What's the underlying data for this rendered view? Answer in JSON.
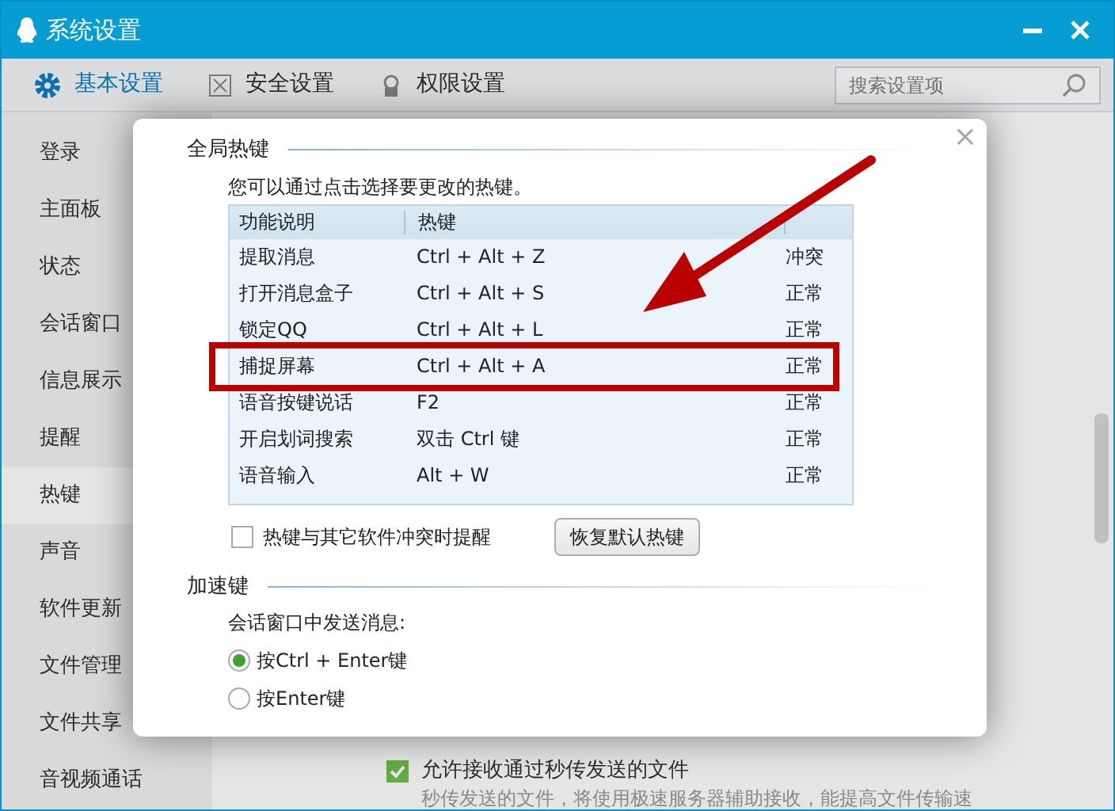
{
  "window": {
    "title": "系统设置"
  },
  "tabs": [
    {
      "label": "基本设置",
      "selected": true
    },
    {
      "label": "安全设置",
      "selected": false
    },
    {
      "label": "权限设置",
      "selected": false
    }
  ],
  "search": {
    "placeholder": "搜索设置项"
  },
  "sidebar": {
    "items": [
      {
        "label": "登录",
        "selected": false
      },
      {
        "label": "主面板",
        "selected": false
      },
      {
        "label": "状态",
        "selected": false
      },
      {
        "label": "会话窗口",
        "selected": false
      },
      {
        "label": "信息展示",
        "selected": false
      },
      {
        "label": "提醒",
        "selected": false
      },
      {
        "label": "热键",
        "selected": true
      },
      {
        "label": "声音",
        "selected": false
      },
      {
        "label": "软件更新",
        "selected": false
      },
      {
        "label": "文件管理",
        "selected": false
      },
      {
        "label": "文件共享",
        "selected": false
      },
      {
        "label": "音视频通话",
        "selected": false
      }
    ]
  },
  "background_option": {
    "label": "允许接收通过秒传发送的文件",
    "checked": true,
    "description": "秒传发送的文件，将使用极速服务器辅助接收，能提高文件传输速"
  },
  "dialog": {
    "close": "×",
    "global_hotkeys": {
      "title": "全局热键",
      "instruction": "您可以通过点击选择要更改的热键。",
      "table": {
        "columns": [
          "功能说明",
          "热键",
          ""
        ],
        "rows": [
          [
            "提取消息",
            "Ctrl + Alt + Z",
            "冲突"
          ],
          [
            "打开消息盒子",
            "Ctrl + Alt + S",
            "正常"
          ],
          [
            "锁定QQ",
            "Ctrl + Alt + L",
            "正常"
          ],
          [
            "捕捉屏幕",
            "Ctrl + Alt + A",
            "正常"
          ],
          [
            "语音按键说话",
            "F2",
            "正常"
          ],
          [
            "开启划词搜索",
            "双击 Ctrl 键",
            "正常"
          ],
          [
            "语音输入",
            "Alt + W",
            "正常"
          ]
        ]
      },
      "conflict_alert": {
        "label": "热键与其它软件冲突时提醒",
        "checked": false
      },
      "restore_button": "恢复默认热键"
    },
    "accelerators": {
      "title": "加速键",
      "label": "会话窗口中发送消息:",
      "options": [
        {
          "label": "按Ctrl + Enter键",
          "selected": true
        },
        {
          "label": "按Enter键",
          "selected": false
        }
      ]
    }
  }
}
